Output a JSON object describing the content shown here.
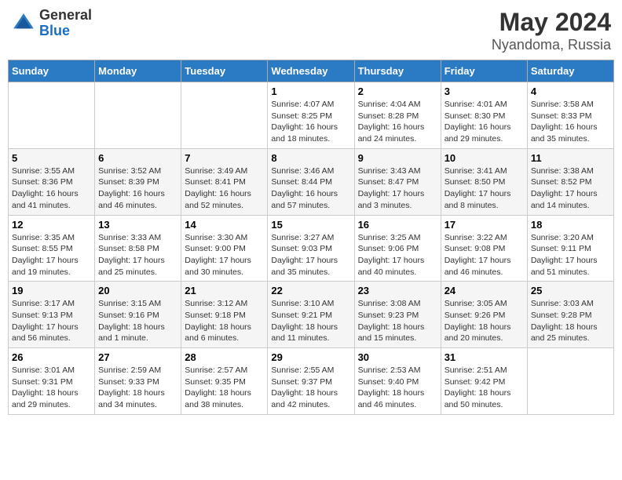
{
  "header": {
    "logo_general": "General",
    "logo_blue": "Blue",
    "title": "May 2024",
    "subtitle": "Nyandoma, Russia"
  },
  "weekdays": [
    "Sunday",
    "Monday",
    "Tuesday",
    "Wednesday",
    "Thursday",
    "Friday",
    "Saturday"
  ],
  "weeks": [
    [
      {
        "day": "",
        "info": ""
      },
      {
        "day": "",
        "info": ""
      },
      {
        "day": "",
        "info": ""
      },
      {
        "day": "1",
        "info": "Sunrise: 4:07 AM\nSunset: 8:25 PM\nDaylight: 16 hours and 18 minutes."
      },
      {
        "day": "2",
        "info": "Sunrise: 4:04 AM\nSunset: 8:28 PM\nDaylight: 16 hours and 24 minutes."
      },
      {
        "day": "3",
        "info": "Sunrise: 4:01 AM\nSunset: 8:30 PM\nDaylight: 16 hours and 29 minutes."
      },
      {
        "day": "4",
        "info": "Sunrise: 3:58 AM\nSunset: 8:33 PM\nDaylight: 16 hours and 35 minutes."
      }
    ],
    [
      {
        "day": "5",
        "info": "Sunrise: 3:55 AM\nSunset: 8:36 PM\nDaylight: 16 hours and 41 minutes."
      },
      {
        "day": "6",
        "info": "Sunrise: 3:52 AM\nSunset: 8:39 PM\nDaylight: 16 hours and 46 minutes."
      },
      {
        "day": "7",
        "info": "Sunrise: 3:49 AM\nSunset: 8:41 PM\nDaylight: 16 hours and 52 minutes."
      },
      {
        "day": "8",
        "info": "Sunrise: 3:46 AM\nSunset: 8:44 PM\nDaylight: 16 hours and 57 minutes."
      },
      {
        "day": "9",
        "info": "Sunrise: 3:43 AM\nSunset: 8:47 PM\nDaylight: 17 hours and 3 minutes."
      },
      {
        "day": "10",
        "info": "Sunrise: 3:41 AM\nSunset: 8:50 PM\nDaylight: 17 hours and 8 minutes."
      },
      {
        "day": "11",
        "info": "Sunrise: 3:38 AM\nSunset: 8:52 PM\nDaylight: 17 hours and 14 minutes."
      }
    ],
    [
      {
        "day": "12",
        "info": "Sunrise: 3:35 AM\nSunset: 8:55 PM\nDaylight: 17 hours and 19 minutes."
      },
      {
        "day": "13",
        "info": "Sunrise: 3:33 AM\nSunset: 8:58 PM\nDaylight: 17 hours and 25 minutes."
      },
      {
        "day": "14",
        "info": "Sunrise: 3:30 AM\nSunset: 9:00 PM\nDaylight: 17 hours and 30 minutes."
      },
      {
        "day": "15",
        "info": "Sunrise: 3:27 AM\nSunset: 9:03 PM\nDaylight: 17 hours and 35 minutes."
      },
      {
        "day": "16",
        "info": "Sunrise: 3:25 AM\nSunset: 9:06 PM\nDaylight: 17 hours and 40 minutes."
      },
      {
        "day": "17",
        "info": "Sunrise: 3:22 AM\nSunset: 9:08 PM\nDaylight: 17 hours and 46 minutes."
      },
      {
        "day": "18",
        "info": "Sunrise: 3:20 AM\nSunset: 9:11 PM\nDaylight: 17 hours and 51 minutes."
      }
    ],
    [
      {
        "day": "19",
        "info": "Sunrise: 3:17 AM\nSunset: 9:13 PM\nDaylight: 17 hours and 56 minutes."
      },
      {
        "day": "20",
        "info": "Sunrise: 3:15 AM\nSunset: 9:16 PM\nDaylight: 18 hours and 1 minute."
      },
      {
        "day": "21",
        "info": "Sunrise: 3:12 AM\nSunset: 9:18 PM\nDaylight: 18 hours and 6 minutes."
      },
      {
        "day": "22",
        "info": "Sunrise: 3:10 AM\nSunset: 9:21 PM\nDaylight: 18 hours and 11 minutes."
      },
      {
        "day": "23",
        "info": "Sunrise: 3:08 AM\nSunset: 9:23 PM\nDaylight: 18 hours and 15 minutes."
      },
      {
        "day": "24",
        "info": "Sunrise: 3:05 AM\nSunset: 9:26 PM\nDaylight: 18 hours and 20 minutes."
      },
      {
        "day": "25",
        "info": "Sunrise: 3:03 AM\nSunset: 9:28 PM\nDaylight: 18 hours and 25 minutes."
      }
    ],
    [
      {
        "day": "26",
        "info": "Sunrise: 3:01 AM\nSunset: 9:31 PM\nDaylight: 18 hours and 29 minutes."
      },
      {
        "day": "27",
        "info": "Sunrise: 2:59 AM\nSunset: 9:33 PM\nDaylight: 18 hours and 34 minutes."
      },
      {
        "day": "28",
        "info": "Sunrise: 2:57 AM\nSunset: 9:35 PM\nDaylight: 18 hours and 38 minutes."
      },
      {
        "day": "29",
        "info": "Sunrise: 2:55 AM\nSunset: 9:37 PM\nDaylight: 18 hours and 42 minutes."
      },
      {
        "day": "30",
        "info": "Sunrise: 2:53 AM\nSunset: 9:40 PM\nDaylight: 18 hours and 46 minutes."
      },
      {
        "day": "31",
        "info": "Sunrise: 2:51 AM\nSunset: 9:42 PM\nDaylight: 18 hours and 50 minutes."
      },
      {
        "day": "",
        "info": ""
      }
    ]
  ]
}
